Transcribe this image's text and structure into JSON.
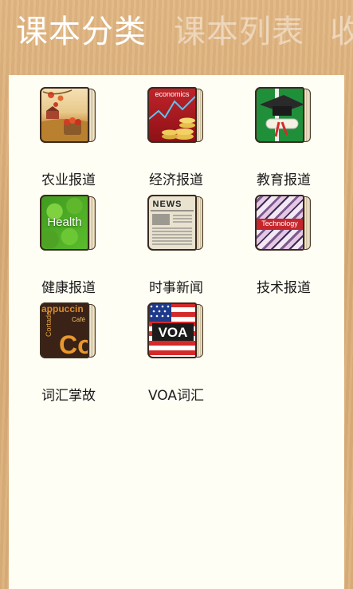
{
  "pivot": {
    "tabs": [
      "课本分类",
      "课本列表",
      "收"
    ]
  },
  "categories": [
    {
      "label": "农业报道",
      "icon": "agriculture-book-icon",
      "cover_text": ""
    },
    {
      "label": "经济报道",
      "icon": "economics-book-icon",
      "cover_text": "economics"
    },
    {
      "label": "教育报道",
      "icon": "education-book-icon",
      "cover_text": ""
    },
    {
      "label": "健康报道",
      "icon": "health-book-icon",
      "cover_text": "Health"
    },
    {
      "label": "时事新闻",
      "icon": "news-book-icon",
      "cover_text": "NEWS"
    },
    {
      "label": "技术报道",
      "icon": "technology-book-icon",
      "cover_text": "Technology"
    },
    {
      "label": "词汇掌故",
      "icon": "vocabulary-book-icon",
      "cover_text": "Co"
    },
    {
      "label": "VOA词汇",
      "icon": "voa-book-icon",
      "cover_text": "VOA"
    }
  ]
}
